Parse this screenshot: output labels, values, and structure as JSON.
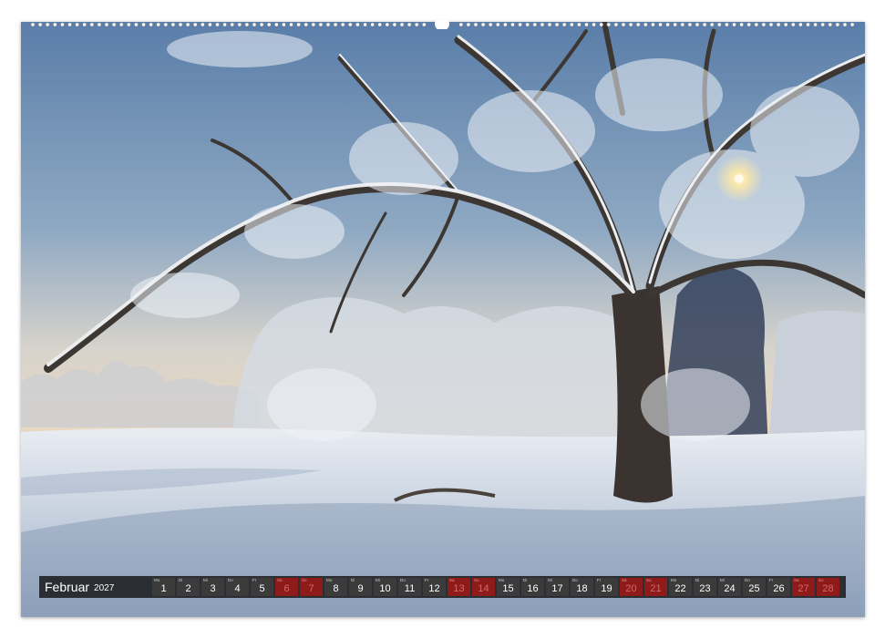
{
  "calendar": {
    "month": "Februar",
    "year": "2027",
    "days": [
      {
        "wd": "Mo",
        "num": "1",
        "weekend": false
      },
      {
        "wd": "Di",
        "num": "2",
        "weekend": false
      },
      {
        "wd": "Mi",
        "num": "3",
        "weekend": false
      },
      {
        "wd": "Do",
        "num": "4",
        "weekend": false
      },
      {
        "wd": "Fr",
        "num": "5",
        "weekend": false
      },
      {
        "wd": "Sa",
        "num": "6",
        "weekend": true
      },
      {
        "wd": "So",
        "num": "7",
        "weekend": true
      },
      {
        "wd": "Mo",
        "num": "8",
        "weekend": false
      },
      {
        "wd": "Di",
        "num": "9",
        "weekend": false
      },
      {
        "wd": "Mi",
        "num": "10",
        "weekend": false
      },
      {
        "wd": "Do",
        "num": "11",
        "weekend": false
      },
      {
        "wd": "Fr",
        "num": "12",
        "weekend": false
      },
      {
        "wd": "Sa",
        "num": "13",
        "weekend": true
      },
      {
        "wd": "So",
        "num": "14",
        "weekend": true
      },
      {
        "wd": "Mo",
        "num": "15",
        "weekend": false
      },
      {
        "wd": "Di",
        "num": "16",
        "weekend": false
      },
      {
        "wd": "Mi",
        "num": "17",
        "weekend": false
      },
      {
        "wd": "Do",
        "num": "18",
        "weekend": false
      },
      {
        "wd": "Fr",
        "num": "19",
        "weekend": false
      },
      {
        "wd": "Sa",
        "num": "20",
        "weekend": true
      },
      {
        "wd": "So",
        "num": "21",
        "weekend": true
      },
      {
        "wd": "Mo",
        "num": "22",
        "weekend": false
      },
      {
        "wd": "Di",
        "num": "23",
        "weekend": false
      },
      {
        "wd": "Mi",
        "num": "24",
        "weekend": false
      },
      {
        "wd": "Do",
        "num": "25",
        "weekend": false
      },
      {
        "wd": "Fr",
        "num": "26",
        "weekend": false
      },
      {
        "wd": "Sa",
        "num": "27",
        "weekend": true
      },
      {
        "wd": "So",
        "num": "28",
        "weekend": true
      }
    ]
  },
  "colors": {
    "bar_background": "#141414",
    "weekday_cell": "#3b3b3b",
    "weekend_cell": "#8f1a1a",
    "sky_top": "#5d7fa8",
    "sky_horizon": "#e9d9c4",
    "snow": "#dfe6ef"
  }
}
